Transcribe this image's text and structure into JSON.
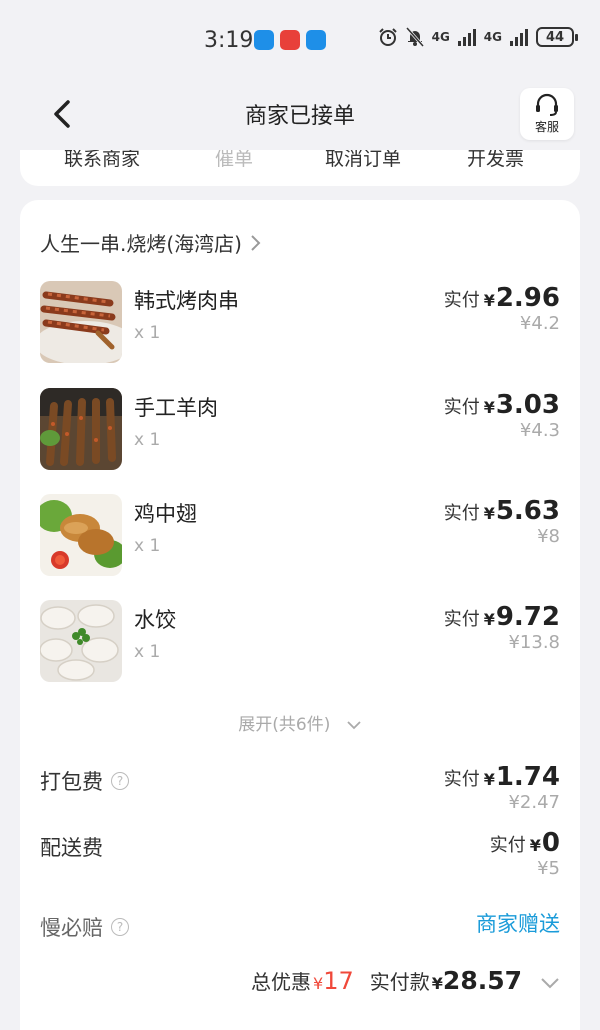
{
  "status_bar": {
    "time": "3:19",
    "signal1": "4G",
    "signal2": "4G",
    "battery": "44"
  },
  "header": {
    "title": "商家已接单",
    "customer_service": "客服"
  },
  "actions": {
    "contact_merchant": "联系商家",
    "urge": "催单",
    "cancel": "取消订单",
    "invoice": "开发票"
  },
  "shop": {
    "name": "人生一串.烧烤(海湾店)"
  },
  "items": [
    {
      "name": "韩式烤肉串",
      "qty": "x 1",
      "paid_label": "实付",
      "currency": "¥",
      "paid": "2.96",
      "original": "¥4.2"
    },
    {
      "name": "手工羊肉",
      "qty": "x 1",
      "paid_label": "实付",
      "currency": "¥",
      "paid": "3.03",
      "original": "¥4.3"
    },
    {
      "name": "鸡中翅",
      "qty": "x 1",
      "paid_label": "实付",
      "currency": "¥",
      "paid": "5.63",
      "original": "¥8"
    },
    {
      "name": "水饺",
      "qty": "x 1",
      "paid_label": "实付",
      "currency": "¥",
      "paid": "9.72",
      "original": "¥13.8"
    }
  ],
  "expand": "展开(共6件)",
  "packing_fee": {
    "label": "打包费",
    "paid_label": "实付",
    "currency": "¥",
    "paid": "1.74",
    "original": "¥2.47"
  },
  "delivery_fee": {
    "label": "配送费",
    "paid_label": "实付",
    "currency": "¥",
    "paid": "0",
    "original": "¥5"
  },
  "slow_compensation": {
    "label": "慢必赔",
    "merchant_gift": "商家赠送"
  },
  "summary": {
    "discount_label": "总优惠",
    "discount_currency": "¥",
    "discount": "17",
    "paid_label": "实付款",
    "paid_currency": "¥",
    "paid": "28.57"
  },
  "colors": {
    "accent_blue": "#1a9bd9",
    "discount_red": "#f0483a",
    "background": "#f2f2f5"
  }
}
